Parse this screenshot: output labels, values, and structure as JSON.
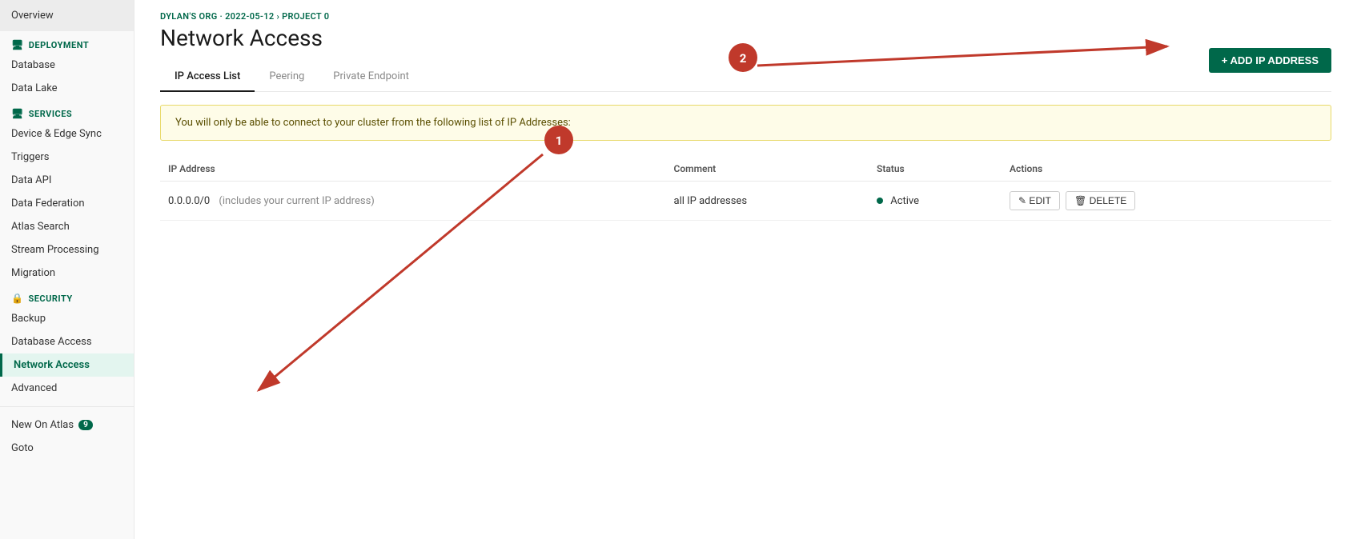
{
  "sidebar": {
    "overview_label": "Overview",
    "deployment_label": "DEPLOYMENT",
    "deployment_icon": "🖥",
    "deployment_items": [
      {
        "id": "database",
        "label": "Database"
      },
      {
        "id": "data-lake",
        "label": "Data Lake"
      }
    ],
    "services_label": "SERVICES",
    "services_icon": "🖥",
    "services_items": [
      {
        "id": "device-edge-sync",
        "label": "Device & Edge Sync"
      },
      {
        "id": "triggers",
        "label": "Triggers"
      },
      {
        "id": "data-api",
        "label": "Data API"
      },
      {
        "id": "data-federation",
        "label": "Data Federation"
      },
      {
        "id": "atlas-search",
        "label": "Atlas Search"
      },
      {
        "id": "stream-processing",
        "label": "Stream Processing"
      },
      {
        "id": "migration",
        "label": "Migration"
      }
    ],
    "security_label": "SECURITY",
    "security_icon": "🔒",
    "security_items": [
      {
        "id": "backup",
        "label": "Backup"
      },
      {
        "id": "database-access",
        "label": "Database Access"
      },
      {
        "id": "network-access",
        "label": "Network Access",
        "active": true
      },
      {
        "id": "advanced",
        "label": "Advanced"
      }
    ],
    "new_on_atlas_label": "New On Atlas",
    "new_on_atlas_badge": "9",
    "goto_label": "Goto"
  },
  "breadcrumb": "DYLAN'S ORG · 2022-05-12 › PROJECT 0",
  "page_title": "Network Access",
  "tabs": [
    {
      "id": "ip-access-list",
      "label": "IP Access List",
      "active": true
    },
    {
      "id": "peering",
      "label": "Peering"
    },
    {
      "id": "private-endpoint",
      "label": "Private Endpoint"
    }
  ],
  "add_ip_button_label": "+ ADD IP ADDRESS",
  "warning_banner": "You will only be able to connect to your cluster from the following list of IP Addresses:",
  "table": {
    "columns": [
      {
        "id": "ip-address",
        "label": "IP Address"
      },
      {
        "id": "comment",
        "label": "Comment"
      },
      {
        "id": "status",
        "label": "Status"
      },
      {
        "id": "actions",
        "label": "Actions"
      }
    ],
    "rows": [
      {
        "ip_address": "0.0.0.0/0",
        "ip_note": "(includes your current IP address)",
        "comment": "all IP addresses",
        "status": "Active",
        "edit_label": "✎ EDIT",
        "delete_label": "🗑 DELETE"
      }
    ]
  },
  "annotations": {
    "circle1_label": "1",
    "circle2_label": "2"
  }
}
